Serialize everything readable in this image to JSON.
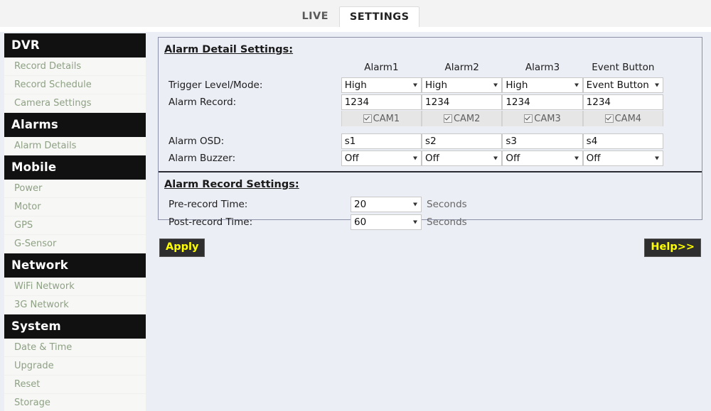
{
  "tabs": [
    {
      "label": "LIVE",
      "active": false
    },
    {
      "label": "SETTINGS",
      "active": true
    }
  ],
  "sidebar": {
    "groups": [
      {
        "header": "DVR",
        "items": [
          "Record Details",
          "Record Schedule",
          "Camera Settings"
        ]
      },
      {
        "header": "Alarms",
        "items": [
          "Alarm Details"
        ]
      },
      {
        "header": "Mobile",
        "items": [
          "Power",
          "Motor",
          "GPS",
          "G-Sensor"
        ]
      },
      {
        "header": "Network",
        "items": [
          "WiFi Network",
          "3G Network"
        ]
      },
      {
        "header": "System",
        "items": [
          "Date & Time",
          "Upgrade",
          "Reset",
          "Storage"
        ]
      }
    ]
  },
  "main": {
    "alarm_detail": {
      "title": "Alarm Detail Settings:",
      "columns": [
        "Alarm1",
        "Alarm2",
        "Alarm3",
        "Event Button"
      ],
      "rows": {
        "trigger_level": {
          "label": "Trigger Level/Mode:",
          "values": [
            "High",
            "High",
            "High",
            "Event Button"
          ]
        },
        "alarm_record": {
          "label": "Alarm Record:",
          "values": [
            "1234",
            "1234",
            "1234",
            "1234"
          ]
        },
        "cameras": [
          "CAM1",
          "CAM2",
          "CAM3",
          "CAM4"
        ],
        "alarm_osd": {
          "label": "Alarm OSD:",
          "values": [
            "s1",
            "s2",
            "s3",
            "s4"
          ]
        },
        "alarm_buzzer": {
          "label": "Alarm Buzzer:",
          "values": [
            "Off",
            "Off",
            "Off",
            "Off"
          ]
        }
      }
    },
    "alarm_record_settings": {
      "title": "Alarm Record Settings:",
      "pre_record": {
        "label": "Pre-record Time:",
        "value": "20",
        "unit": "Seconds"
      },
      "post_record": {
        "label": "Post-record Time:",
        "value": "60",
        "unit": "Seconds"
      }
    },
    "buttons": {
      "apply": "Apply",
      "help": "Help>>"
    }
  },
  "colors": {
    "sidebar_header_bg": "#111111",
    "sidebar_link": "#8ea184",
    "panel_bg": "#eceef6",
    "button_bg": "#2e2e2e",
    "button_text": "#ffff00"
  }
}
